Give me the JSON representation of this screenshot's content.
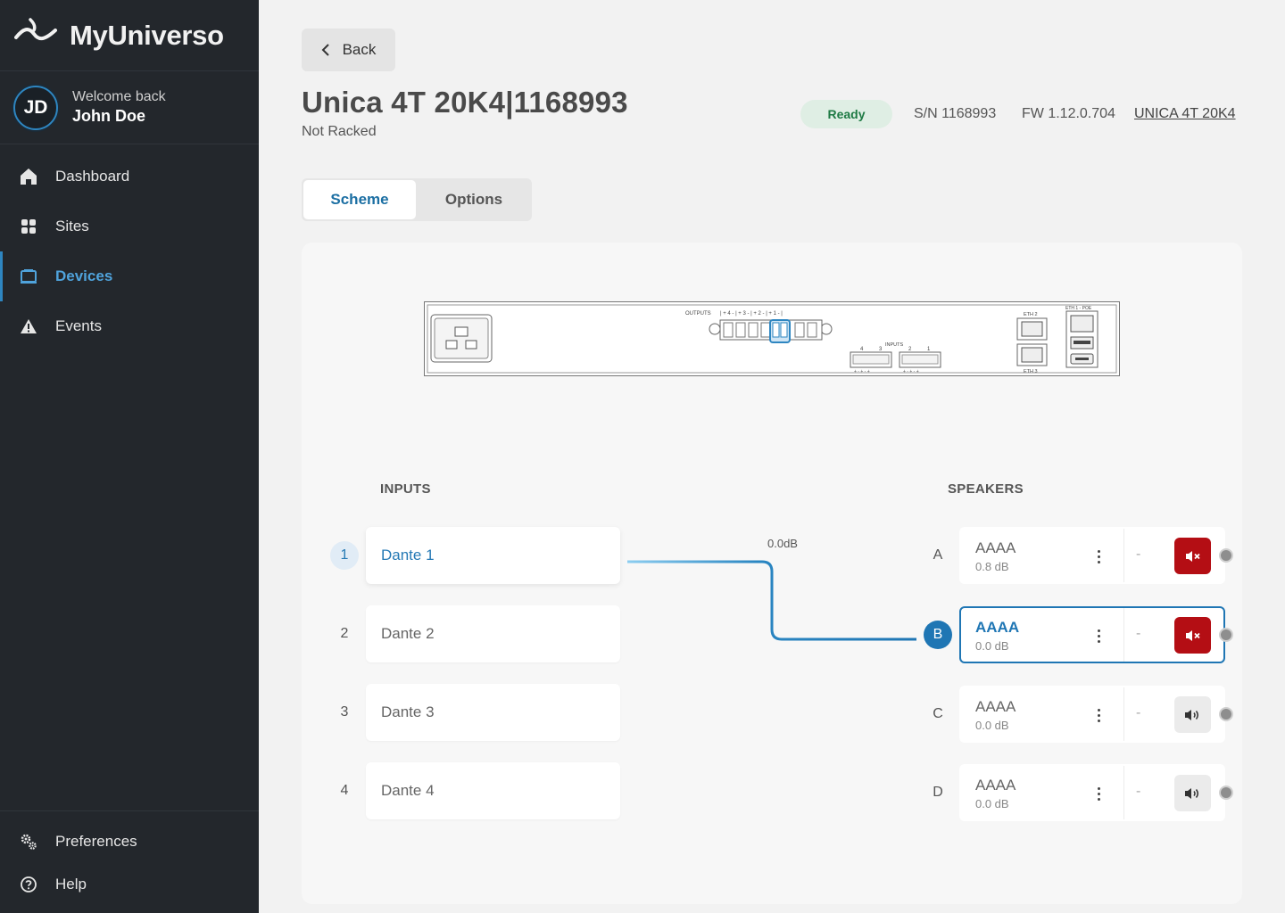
{
  "app": {
    "brand": "MyUniverso"
  },
  "user": {
    "initials": "JD",
    "welcome": "Welcome back",
    "name": "John Doe"
  },
  "nav": {
    "items": [
      {
        "label": "Dashboard",
        "icon": "home-icon"
      },
      {
        "label": "Sites",
        "icon": "grid-icon"
      },
      {
        "label": "Devices",
        "icon": "device-icon",
        "active": true
      },
      {
        "label": "Events",
        "icon": "warning-icon"
      }
    ],
    "bottom": [
      {
        "label": "Preferences",
        "icon": "gears-icon"
      },
      {
        "label": "Help",
        "icon": "help-icon"
      }
    ]
  },
  "header": {
    "back_label": "Back",
    "title": "Unica 4T 20K4|1168993",
    "subtitle": "Not Racked",
    "status": "Ready",
    "serial": "S/N 1168993",
    "firmware": "FW 1.12.0.704",
    "model_link": "UNICA 4T 20K4"
  },
  "tabs": [
    {
      "label": "Scheme",
      "active": true
    },
    {
      "label": "Options",
      "active": false
    }
  ],
  "device_panel": {
    "labels": {
      "outputs": "OUTPUTS",
      "output_terminals": "| + 4 - | + 3 - | + 2 - | + 1 - |",
      "inputs": "INPUTS",
      "input_numbers": [
        "4",
        "3",
        "2",
        "1"
      ],
      "input_polarity": "+ - + - +",
      "eth2": "ETH 2",
      "eth3": "ETH 3",
      "eth1_poe": "ETH 1 - POE"
    }
  },
  "scheme": {
    "inputs_title": "INPUTS",
    "speakers_title": "SPEAKERS",
    "route_gain": "0.0dB",
    "inputs": [
      {
        "number": "1",
        "name": "Dante 1",
        "active": true
      },
      {
        "number": "2",
        "name": "Dante 2",
        "active": false
      },
      {
        "number": "3",
        "name": "Dante 3",
        "active": false
      },
      {
        "number": "4",
        "name": "Dante 4",
        "active": false
      }
    ],
    "speakers": [
      {
        "letter": "A",
        "name": "AAAA",
        "gain": "0.8 dB",
        "dash": "-",
        "muted": true,
        "active": false
      },
      {
        "letter": "B",
        "name": "AAAA",
        "gain": "0.0 dB",
        "dash": "-",
        "muted": true,
        "active": true
      },
      {
        "letter": "C",
        "name": "AAAA",
        "gain": "0.0 dB",
        "dash": "-",
        "muted": false,
        "active": false
      },
      {
        "letter": "D",
        "name": "AAAA",
        "gain": "0.0 dB",
        "dash": "-",
        "muted": false,
        "active": false
      }
    ]
  },
  "colors": {
    "sidebar_bg": "#23272c",
    "accent": "#1f76b4",
    "status_ok": "#1e7a44",
    "mute_red": "#b40e14"
  }
}
